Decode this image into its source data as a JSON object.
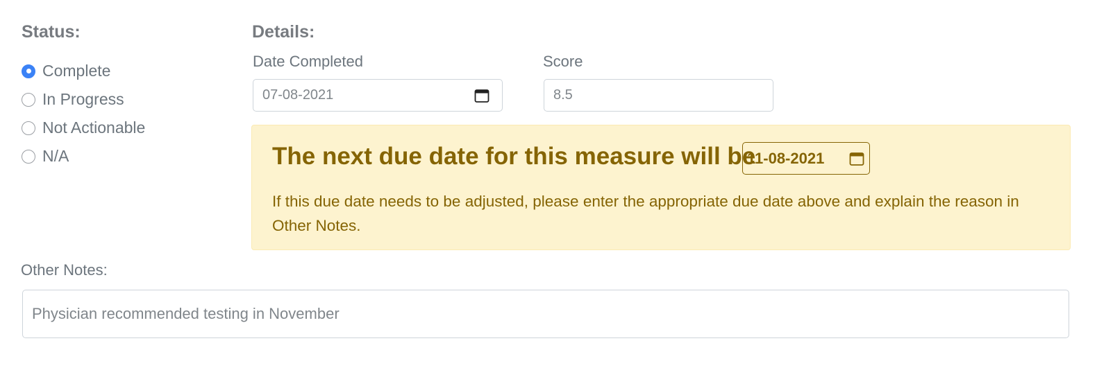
{
  "status": {
    "heading": "Status:",
    "options": [
      {
        "label": "Complete",
        "checked": true
      },
      {
        "label": "In Progress",
        "checked": false
      },
      {
        "label": "Not Actionable",
        "checked": false
      },
      {
        "label": "N/A",
        "checked": false
      }
    ]
  },
  "details": {
    "heading": "Details:",
    "date_completed": {
      "label": "Date Completed",
      "value": "07-08-2021"
    },
    "score": {
      "label": "Score",
      "value": "8.5"
    }
  },
  "alert": {
    "title": "The next due date for this measure will be",
    "due_date": "11-08-2021",
    "text": "If this due date needs to be adjusted, please enter the appropriate due date above and explain the reason in Other Notes."
  },
  "other_notes": {
    "label": "Other Notes:",
    "value": "Physician recommended testing in November"
  },
  "icons": {
    "calendar": "calendar-icon"
  },
  "colors": {
    "accent": "#3b82f6",
    "alert_background": "#fdf3cf",
    "alert_text": "#856404"
  }
}
